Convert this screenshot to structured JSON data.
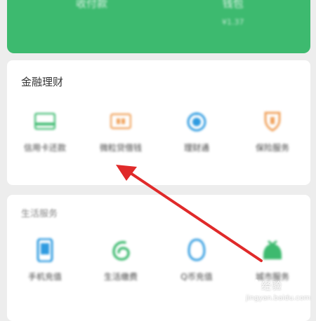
{
  "header_card": {
    "items": [
      {
        "label": "收付款",
        "sub": ""
      },
      {
        "label": "钱包",
        "sub": "¥1.37"
      }
    ]
  },
  "finance": {
    "title": "金融理财",
    "items": [
      {
        "label": "信用卡还款",
        "icon": "credit-card-icon",
        "color": "#3dba6f"
      },
      {
        "label": "微粒贷借钱",
        "icon": "loan-card-icon",
        "color": "#f0a25c"
      },
      {
        "label": "理财通",
        "icon": "wealth-icon",
        "color": "#2f9be0"
      },
      {
        "label": "保险服务",
        "icon": "insurance-icon",
        "color": "#f0a25c"
      }
    ]
  },
  "life": {
    "title": "生活服务",
    "items": [
      {
        "label": "手机充值",
        "icon": "phone-icon",
        "color": "#2f9be0"
      },
      {
        "label": "生活缴费",
        "icon": "utility-icon",
        "color": "#3dba6f"
      },
      {
        "label": "Q币充值",
        "icon": "qcoin-icon",
        "color": "#2f9be0"
      },
      {
        "label": "城市服务",
        "icon": "city-icon",
        "color": "#3dba6f"
      }
    ]
  },
  "watermark": {
    "main": "经验",
    "sub": "jingyan.baidu.com"
  },
  "colors": {
    "accent_green": "#3dba6f",
    "annotation_red": "#e02a2a"
  }
}
